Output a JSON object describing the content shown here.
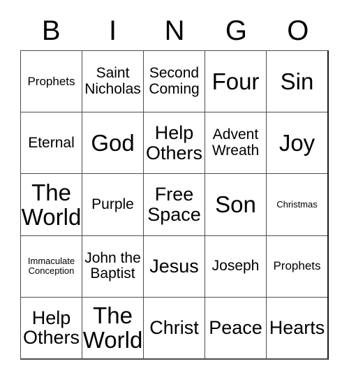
{
  "card": {
    "header": {
      "letters": [
        "B",
        "I",
        "N",
        "G",
        "O"
      ]
    },
    "rows": [
      [
        {
          "text": "Prophets",
          "size": "sm"
        },
        {
          "text": "Saint Nicholas",
          "size": "md"
        },
        {
          "text": "Second Coming",
          "size": "md"
        },
        {
          "text": "Four",
          "size": "xl"
        },
        {
          "text": "Sin",
          "size": "xl"
        }
      ],
      [
        {
          "text": "Eternal",
          "size": "md"
        },
        {
          "text": "God",
          "size": "xl"
        },
        {
          "text": "Help Others",
          "size": "lg"
        },
        {
          "text": "Advent Wreath",
          "size": "md"
        },
        {
          "text": "Joy",
          "size": "xl"
        }
      ],
      [
        {
          "text": "The World",
          "size": "xl"
        },
        {
          "text": "Purple",
          "size": "md"
        },
        {
          "text": "Free Space",
          "size": "lg"
        },
        {
          "text": "Son",
          "size": "xl"
        },
        {
          "text": "Christmas",
          "size": "xs"
        }
      ],
      [
        {
          "text": "Immaculate Conception",
          "size": "xs"
        },
        {
          "text": "John the Baptist",
          "size": "md"
        },
        {
          "text": "Jesus",
          "size": "lg"
        },
        {
          "text": "Joseph",
          "size": "md"
        },
        {
          "text": "Prophets",
          "size": "sm"
        }
      ],
      [
        {
          "text": "Help Others",
          "size": "lg"
        },
        {
          "text": "The World",
          "size": "xl"
        },
        {
          "text": "Christ",
          "size": "lg"
        },
        {
          "text": "Peace",
          "size": "lg"
        },
        {
          "text": "Hearts",
          "size": "lg"
        }
      ]
    ]
  }
}
